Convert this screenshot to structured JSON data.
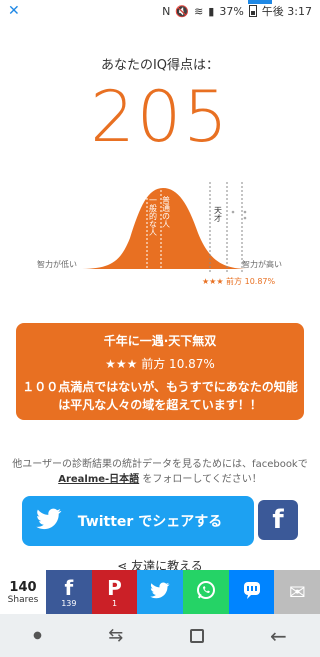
{
  "status_bar": {
    "battery": "37%",
    "time": "午後 3:17"
  },
  "iq": {
    "heading": "あなたのIQ得点は：",
    "score": "205"
  },
  "curve": {
    "low_label": "智力が低い",
    "high_label": "智力が高い",
    "rank_label": "★★★ 前方 10.87%",
    "center_label_1": "普通の人",
    "center_label_2": "一般的な人",
    "genius_label": "天才"
  },
  "result": {
    "title": "千年に一遇·天下無双",
    "rank": "★★★ 前方 10.87%",
    "description": "１００点満点ではないが、もうすでにあなたの知能は平凡な人々の域を超えています！！"
  },
  "share_note": {
    "text_before": "他ユーザーの診断結果の統計データを見るためには、facebookで",
    "link": "Arealme-日本語",
    "text_after": " をフォローしてください！"
  },
  "twitter_button": {
    "label": "Twitter でシェアする"
  },
  "tell_friends": "友達に教える",
  "share_bar": {
    "count": "140",
    "count_label": "Shares",
    "buttons": [
      {
        "name": "facebook",
        "icon": "f",
        "count": "139",
        "color": "#3b5998"
      },
      {
        "name": "pinterest",
        "icon": "P",
        "count": "1",
        "color": "#cb2027"
      },
      {
        "name": "twitter",
        "icon": "t",
        "count": "",
        "color": "#1da1f2"
      },
      {
        "name": "whatsapp",
        "icon": "w",
        "count": "",
        "color": "#25d366"
      },
      {
        "name": "line",
        "icon": "L",
        "count": "",
        "color": "#0084ff"
      },
      {
        "name": "email",
        "icon": "✉",
        "count": "",
        "color": "#bdbdbd"
      }
    ]
  },
  "colors": {
    "accent": "#e87022",
    "twitter": "#1da1f2",
    "facebook": "#3b5998"
  }
}
